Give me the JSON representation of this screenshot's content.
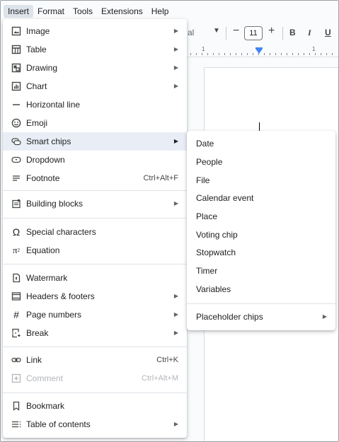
{
  "menubar": {
    "items": [
      "Insert",
      "Format",
      "Tools",
      "Extensions",
      "Help"
    ],
    "active": "Insert"
  },
  "toolbar": {
    "font_fragment": "al",
    "font_size": "11",
    "minus": "−",
    "plus": "+",
    "bold": "B",
    "italic": "I",
    "underline": "U"
  },
  "ruler": {
    "labels": [
      "1",
      "1"
    ]
  },
  "insert_menu": {
    "items": [
      {
        "label": "Image",
        "icon": "image-icon",
        "submenu": true
      },
      {
        "label": "Table",
        "icon": "table-icon",
        "submenu": true
      },
      {
        "label": "Drawing",
        "icon": "drawing-icon",
        "submenu": true
      },
      {
        "label": "Chart",
        "icon": "chart-icon",
        "submenu": true
      },
      {
        "label": "Horizontal line",
        "icon": "horizontal-line-icon"
      },
      {
        "label": "Emoji",
        "icon": "emoji-icon"
      },
      {
        "label": "Smart chips",
        "icon": "smart-chips-icon",
        "submenu": true,
        "hover": true
      },
      {
        "label": "Dropdown",
        "icon": "dropdown-icon"
      },
      {
        "label": "Footnote",
        "icon": "footnote-icon",
        "shortcut": "Ctrl+Alt+F"
      },
      {
        "label": "Building blocks",
        "icon": "building-blocks-icon",
        "submenu": true
      },
      {
        "label": "Special characters",
        "icon": "omega-icon"
      },
      {
        "label": "Equation",
        "icon": "pi-icon"
      },
      {
        "label": "Watermark",
        "icon": "watermark-icon"
      },
      {
        "label": "Headers & footers",
        "icon": "headers-footers-icon",
        "submenu": true
      },
      {
        "label": "Page numbers",
        "icon": "hash-icon",
        "submenu": true
      },
      {
        "label": "Break",
        "icon": "break-icon",
        "submenu": true
      },
      {
        "label": "Link",
        "icon": "link-icon",
        "shortcut": "Ctrl+K"
      },
      {
        "label": "Comment",
        "icon": "comment-icon",
        "shortcut": "Ctrl+Alt+M",
        "disabled": true
      },
      {
        "label": "Bookmark",
        "icon": "bookmark-icon"
      },
      {
        "label": "Table of contents",
        "icon": "toc-icon",
        "submenu": true
      }
    ]
  },
  "smart_chips_menu": {
    "items": [
      {
        "label": "Date"
      },
      {
        "label": "People"
      },
      {
        "label": "File"
      },
      {
        "label": "Calendar event"
      },
      {
        "label": "Place"
      },
      {
        "label": "Voting chip"
      },
      {
        "label": "Stopwatch"
      },
      {
        "label": "Timer"
      },
      {
        "label": "Variables"
      },
      {
        "label": "Placeholder chips",
        "submenu": true
      }
    ]
  },
  "colors": {
    "hover": "#e9eef6",
    "menubar_active": "#dde3ea",
    "ruler_marker": "#4285f4",
    "disabled_text": "#b3b6ba"
  }
}
